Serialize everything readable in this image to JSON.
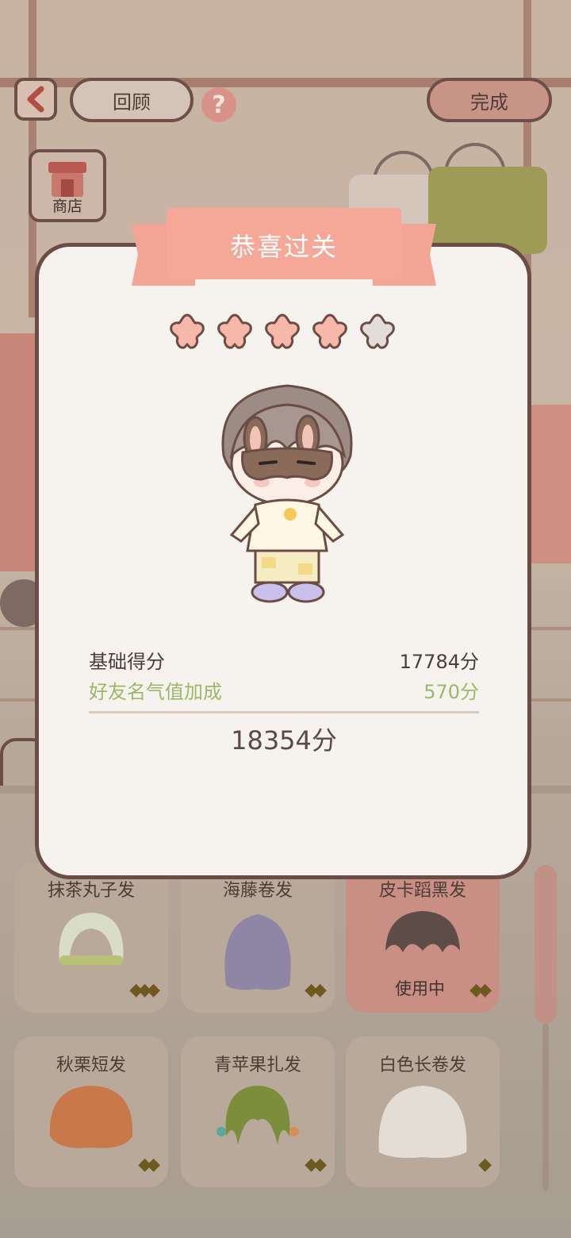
{
  "top_bar": {
    "review_label": "回顾",
    "help_label": "?",
    "done_label": "完成",
    "shop_label": "商店"
  },
  "dialog": {
    "title": "恭喜过关",
    "stars_total": 5,
    "stars_earned": 4,
    "base_score_label": "基础得分",
    "base_score_value": "17784分",
    "bonus_label": "好友名气值加成",
    "bonus_value": "570分",
    "total_score": "18354分"
  },
  "items": [
    {
      "name": "抹茶丸子发",
      "hair_color": "#d9dcc7",
      "rarity": "◆◆◆"
    },
    {
      "name": "海藤卷发",
      "hair_color": "#8f86a6",
      "rarity": "◆◆"
    },
    {
      "name": "皮卡蹈黑发",
      "hair_color": "#5e4c48",
      "rarity": "◆◆",
      "status": "使用中"
    },
    {
      "name": "秋栗短发",
      "hair_color": "#c9784c",
      "rarity": "◆◆"
    },
    {
      "name": "青苹果扎发",
      "hair_color": "#7c8d3c",
      "rarity": "◆◆"
    },
    {
      "name": "白色长卷发",
      "hair_color": "#e3ddd6",
      "rarity": "◆"
    }
  ],
  "colors": {
    "accent_pink": "#f5a898",
    "bonus_green": "#9bb86a",
    "border_brown": "#6b4d45",
    "star_filled": "#f7b8aa",
    "star_empty": "#e2ddd8"
  }
}
